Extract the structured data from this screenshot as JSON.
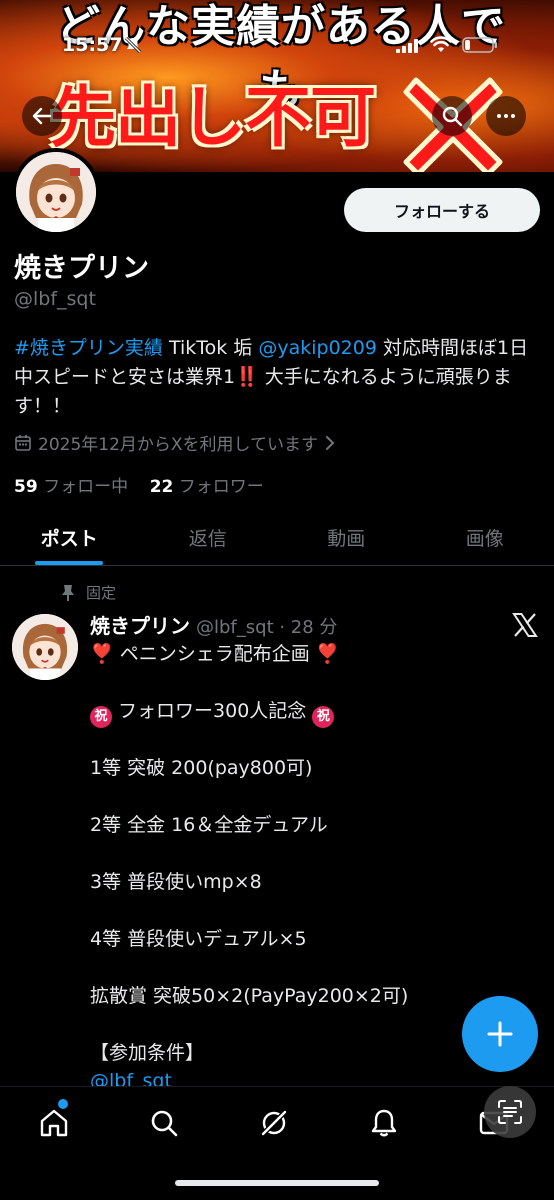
{
  "status_bar": {
    "time": "15:57"
  },
  "banner": {
    "top_text": "どんな実績がある人でも",
    "main_text": "先出し不可"
  },
  "profile": {
    "follow_label": "フォローする",
    "display_name": "焼きプリン",
    "handle": "@lbf_sqt",
    "bio": {
      "hashtag": "#焼きプリン実績",
      "text1": " TikTok 垢 ",
      "mention": "@yakip0209",
      "text2": " 対応時間ほぼ1日中スピードと安さは業界1",
      "bang": "‼️",
      "text3": " 大手になれるように頑張ります！！"
    },
    "joined": "2025年12月からXを利用しています",
    "following_count": "59",
    "following_label": "フォロー中",
    "followers_count": "22",
    "followers_label": "フォロワー"
  },
  "tabs": [
    {
      "label": "ポスト",
      "active": true
    },
    {
      "label": "返信",
      "active": false
    },
    {
      "label": "動画",
      "active": false
    },
    {
      "label": "画像",
      "active": false
    }
  ],
  "post": {
    "pinned_label": "固定",
    "author_name": "焼きプリン",
    "author_meta": "@lbf_sqt · 28 分",
    "title": "ペニンシェラ配布企画",
    "heart": "❣️",
    "iwai_char": "祝",
    "celebration": "フォロワー300人記念",
    "lines": [
      "1等  突破 200(pay800可)",
      "2等 全金 16＆全金デュアル",
      "3等 普段使いmp×8",
      "4等 普段使いデュアル×5",
      "拡散賞 突破50×2(PayPay200×2可)",
      "【参加条件】"
    ],
    "mention": "@lbf_sqt"
  },
  "colors": {
    "accent": "#1d9bf0",
    "background": "#000000",
    "secondary_text": "#71767b",
    "primary_text": "#e7e9ea"
  }
}
